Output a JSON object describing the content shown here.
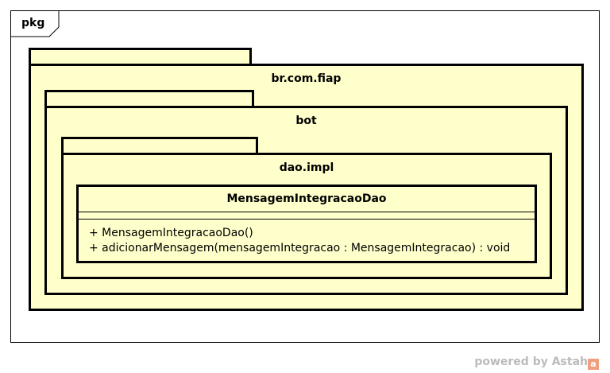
{
  "frame": {
    "label": "pkg"
  },
  "packages": [
    {
      "name": "br.com.fiap"
    },
    {
      "name": "bot"
    },
    {
      "name": "dao.impl"
    }
  ],
  "class": {
    "name": "MensagemIntegracaoDao",
    "operations": [
      "+ MensagemIntegracaoDao()",
      "+ adicionarMensagem(mensagemIntegracao : MensagemIntegracao) : void"
    ]
  },
  "watermark": {
    "text": "powered by Astah",
    "logo": "a"
  }
}
